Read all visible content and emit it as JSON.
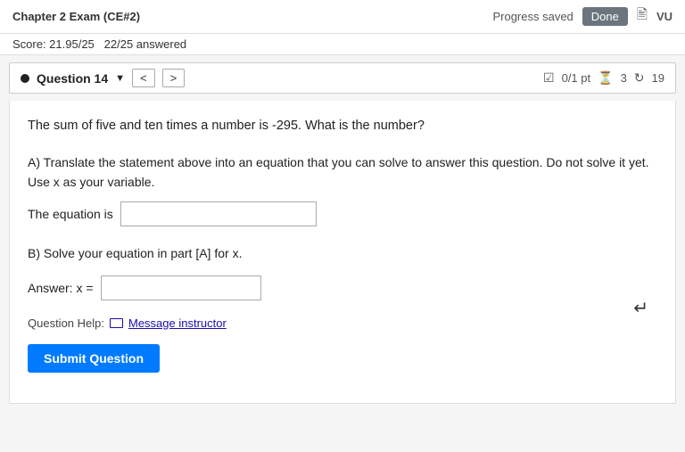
{
  "topbar": {
    "title": "Chapter 2 Exam (CE#2)",
    "progress_saved": "Progress saved",
    "done_label": "Done",
    "user_score_display": "VU"
  },
  "scorebar": {
    "score": "Score: 21.95/25",
    "answered": "22/25 answered"
  },
  "question_nav": {
    "label": "Question 14",
    "prev_arrow": "<",
    "next_arrow": ">",
    "points": "0/1 pt",
    "retries": "3",
    "submissions": "19"
  },
  "question": {
    "text": "The sum of five and ten times a number is -295. What is the number?",
    "part_a_label": "A) Translate the statement above into an equation that you can solve to answer this question. Do not solve it yet. Use x as your variable.",
    "equation_label": "The equation is",
    "equation_placeholder": "",
    "part_b_label": "B) Solve your equation in part [A] for x.",
    "answer_label": "Answer: x =",
    "answer_placeholder": "",
    "help_label": "Question Help:",
    "message_link": "Message instructor",
    "submit_label": "Submit Question"
  }
}
